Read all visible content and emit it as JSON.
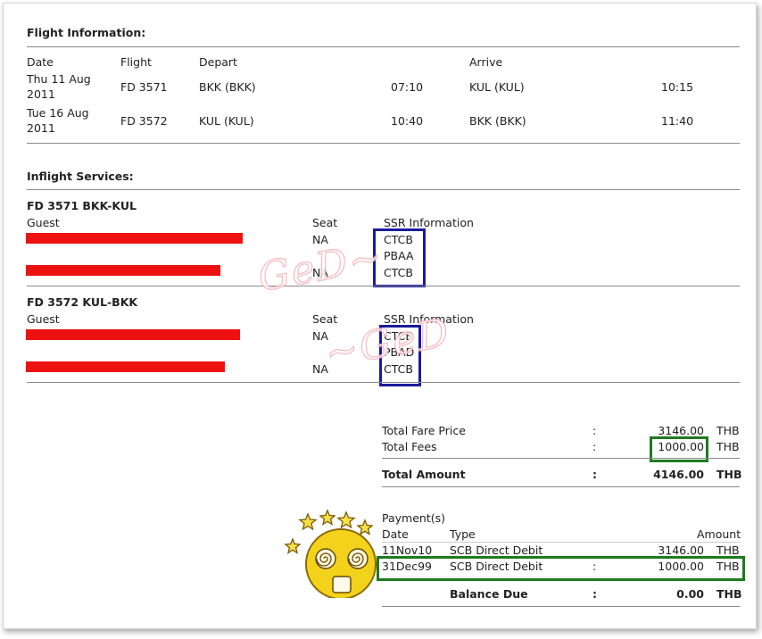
{
  "flight_info": {
    "title": "Flight Information:",
    "headers": {
      "date": "Date",
      "flight": "Flight",
      "depart": "Depart",
      "arrive": "Arrive"
    },
    "rows": [
      {
        "date_line1": "Thu 11 Aug",
        "date_line2": "2011",
        "flight": "FD 3571",
        "depart": "BKK (BKK)",
        "depart_time": "07:10",
        "arrive": "KUL (KUL)",
        "arrive_time": "10:15"
      },
      {
        "date_line1": "Tue 16 Aug",
        "date_line2": "2011",
        "flight": "FD 3572",
        "depart": "KUL (KUL)",
        "depart_time": "10:40",
        "arrive": "BKK (BKK)",
        "arrive_time": "11:40"
      }
    ]
  },
  "inflight": {
    "title": "Inflight Services:",
    "segments": [
      {
        "name": "FD 3571 BKK-KUL",
        "headers": {
          "guest": "Guest",
          "seat": "Seat",
          "ssr": "SSR Information"
        },
        "guests": [
          {
            "seat": "NA",
            "ssr": [
              "CTCB",
              "PBAA"
            ]
          },
          {
            "seat": "NA",
            "ssr": [
              "CTCB"
            ]
          }
        ]
      },
      {
        "name": "FD 3572 KUL-BKK",
        "headers": {
          "guest": "Guest",
          "seat": "Seat",
          "ssr": "SSR Information"
        },
        "guests": [
          {
            "seat": "NA",
            "ssr": [
              "CTCB",
              "PBAD"
            ]
          },
          {
            "seat": "NA",
            "ssr": [
              "CTCB"
            ]
          }
        ]
      }
    ]
  },
  "totals": {
    "fare_label": "Total Fare Price",
    "fare_value": "3146.00",
    "fare_currency": "THB",
    "fees_label": "Total Fees",
    "fees_value": "1000.00",
    "fees_currency": "THB",
    "amount_label": "Total Amount",
    "amount_value": "4146.00",
    "amount_currency": "THB",
    "colon": ":"
  },
  "payments": {
    "title": "Payment(s)",
    "headers": {
      "date": "Date",
      "type": "Type",
      "amount": "Amount"
    },
    "rows": [
      {
        "date": "11Nov10",
        "type": "SCB Direct Debit",
        "amount": "3146.00",
        "currency": "THB"
      },
      {
        "date": "31Dec99",
        "type": "SCB Direct Debit",
        "amount": "1000.00",
        "currency": "THB"
      }
    ],
    "balance_label": "Balance Due",
    "balance_value": "0.00",
    "balance_currency": "THB",
    "colon": ":"
  },
  "watermark": {
    "line1": "GeD~",
    "line2": "~GeD"
  },
  "colors": {
    "redaction": "#ee1111",
    "ssr_box": "#1a1a9c",
    "highlight_box": "#1e7a1e",
    "smiley": "#f3d21c"
  }
}
